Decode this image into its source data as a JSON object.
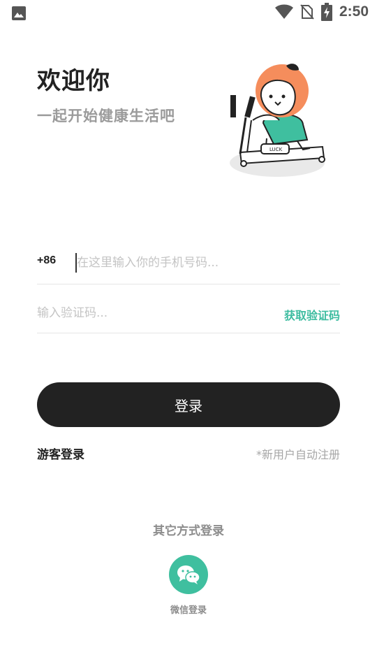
{
  "status_bar": {
    "time": "2:50",
    "icons": [
      "image-icon",
      "wifi-icon",
      "no-sim-icon",
      "battery-charging-icon"
    ]
  },
  "header": {
    "title": "欢迎你",
    "subtitle": "一起开始健康生活吧",
    "illustration_text": "LUCK"
  },
  "form": {
    "country_code": "+86",
    "phone_placeholder": "在这里输入你的手机号码...",
    "code_placeholder": "输入验证码...",
    "get_code_label": "获取验证码"
  },
  "actions": {
    "login_label": "登录",
    "guest_label": "游客登录",
    "auto_register_note": "*新用户自动注册"
  },
  "other_login": {
    "title": "其它方式登录",
    "wechat_label": "微信登录"
  },
  "colors": {
    "accent": "#3dbca0",
    "primary_button": "#222222",
    "muted_text": "#9b9b9b",
    "mascot_orange": "#f58d5c"
  }
}
